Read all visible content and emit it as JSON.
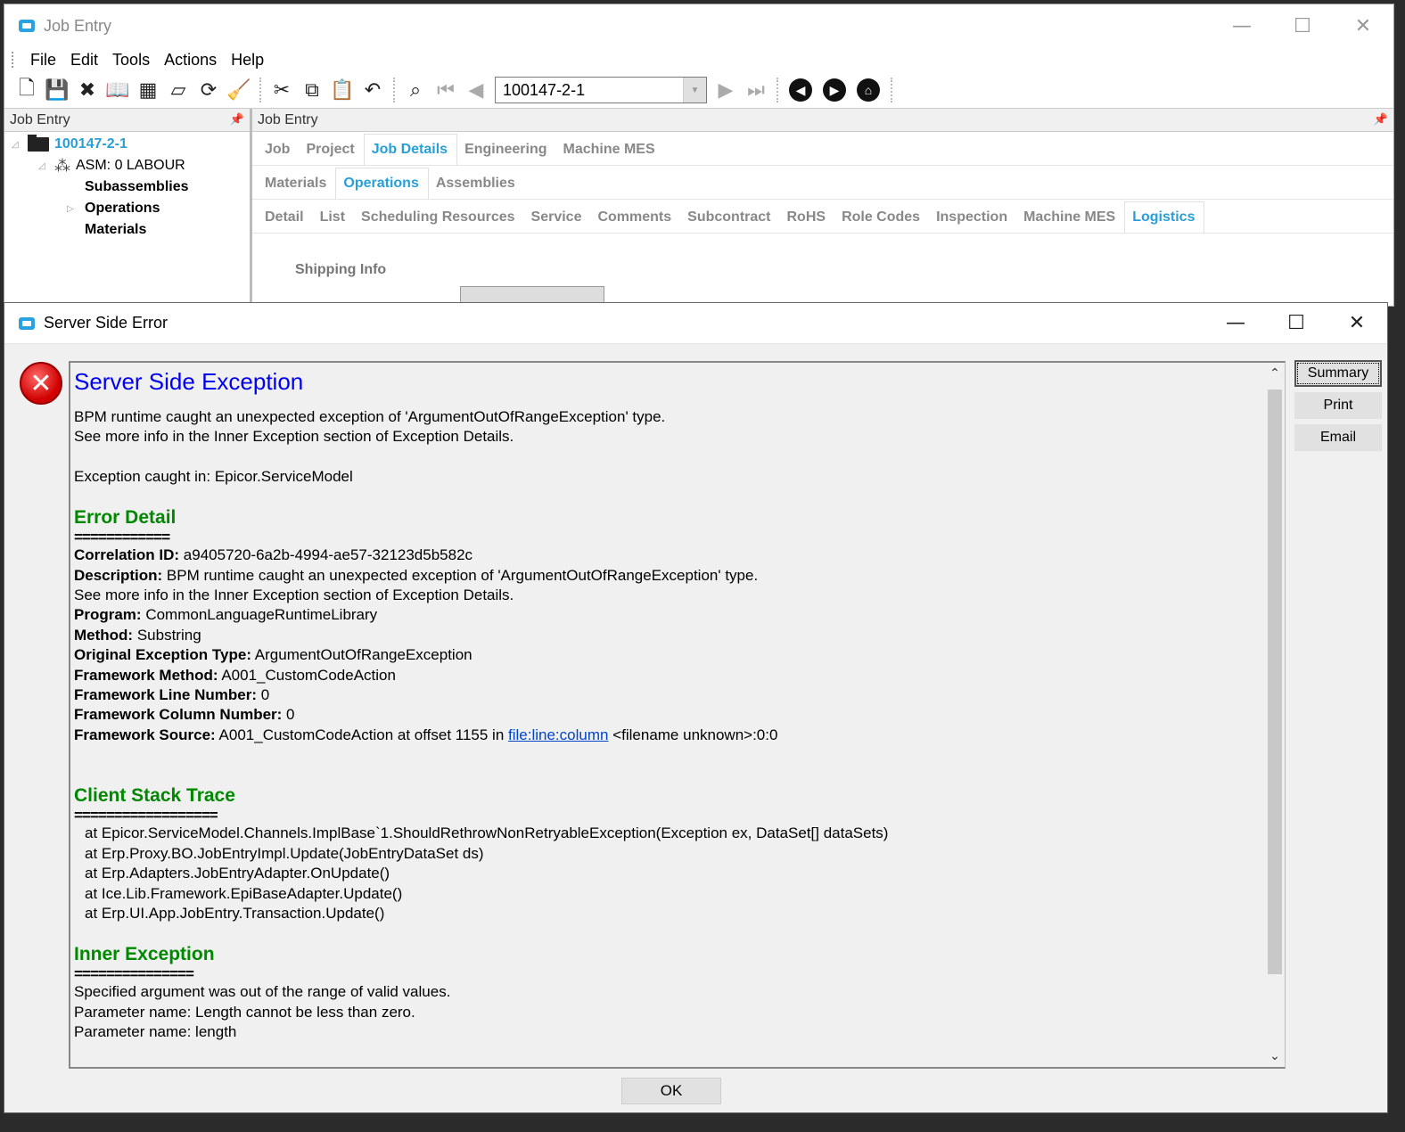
{
  "main_window": {
    "title": "Job Entry",
    "controls": {
      "minimize": "—",
      "maximize": "☐",
      "close": "✕"
    },
    "menu": [
      "File",
      "Edit",
      "Tools",
      "Actions",
      "Help"
    ],
    "job_number": "100147-2-1"
  },
  "left_panel": {
    "header": "Job Entry",
    "tree": {
      "root": "100147-2-1",
      "assembly": "ASM: 0 LABOUR",
      "children": [
        "Subassemblies",
        "Operations",
        "Materials"
      ]
    }
  },
  "right_panel": {
    "header": "Job Entry",
    "tabs_level1": [
      "Job",
      "Project",
      "Job Details",
      "Engineering",
      "Machine MES"
    ],
    "tabs_level2": [
      "Materials",
      "Operations",
      "Assemblies"
    ],
    "tabs_level3": [
      "Detail",
      "List",
      "Scheduling Resources",
      "Service",
      "Comments",
      "Subcontract",
      "RoHS",
      "Role Codes",
      "Inspection",
      "Machine MES",
      "Logistics"
    ],
    "shipping_info": "Shipping Info"
  },
  "dialog": {
    "title": "Server Side Error",
    "heading": "Server Side Exception",
    "intro": [
      "BPM runtime caught an unexpected exception of 'ArgumentOutOfRangeException' type.",
      "See more info in the Inner Exception section of Exception Details."
    ],
    "caught_in": "Exception caught in: Epicor.ServiceModel",
    "error_detail": {
      "heading": "Error Detail",
      "rule": "============",
      "correlation_label": "Correlation ID:",
      "correlation_value": "a9405720-6a2b-4994-ae57-32123d5b582c",
      "description_label": "Description:",
      "description_value": "BPM runtime caught an unexpected exception of 'ArgumentOutOfRangeException' type.",
      "description_line2": "See more info in the Inner Exception section of Exception Details.",
      "program_label": "Program:",
      "program_value": "CommonLanguageRuntimeLibrary",
      "method_label": "Method:",
      "method_value": "Substring",
      "orig_type_label": "Original Exception Type:",
      "orig_type_value": "ArgumentOutOfRangeException",
      "fw_method_label": "Framework Method:",
      "fw_method_value": "A001_CustomCodeAction",
      "fw_line_label": "Framework Line Number:",
      "fw_line_value": "0",
      "fw_col_label": "Framework Column Number:",
      "fw_col_value": "0",
      "fw_source_label": "Framework Source:",
      "fw_source_value": "A001_CustomCodeAction at offset 1155 in",
      "fw_source_link": "file:line:column",
      "fw_source_tail": "<filename unknown>:0:0"
    },
    "client_stack": {
      "heading": "Client Stack Trace",
      "rule": "==================",
      "lines": [
        "at Epicor.ServiceModel.Channels.ImplBase`1.ShouldRethrowNonRetryableException(Exception ex, DataSet[] dataSets)",
        "at Erp.Proxy.BO.JobEntryImpl.Update(JobEntryDataSet ds)",
        "at Erp.Adapters.JobEntryAdapter.OnUpdate()",
        "at Ice.Lib.Framework.EpiBaseAdapter.Update()",
        "at Erp.UI.App.JobEntry.Transaction.Update()"
      ]
    },
    "inner_exception": {
      "heading": "Inner Exception",
      "rule": "===============",
      "lines": [
        "Specified argument was out of the range of valid values.",
        "Parameter name: Length cannot be less than zero.",
        "Parameter name: length"
      ]
    },
    "buttons": {
      "summary": "Summary",
      "print": "Print",
      "email": "Email",
      "ok": "OK"
    }
  }
}
